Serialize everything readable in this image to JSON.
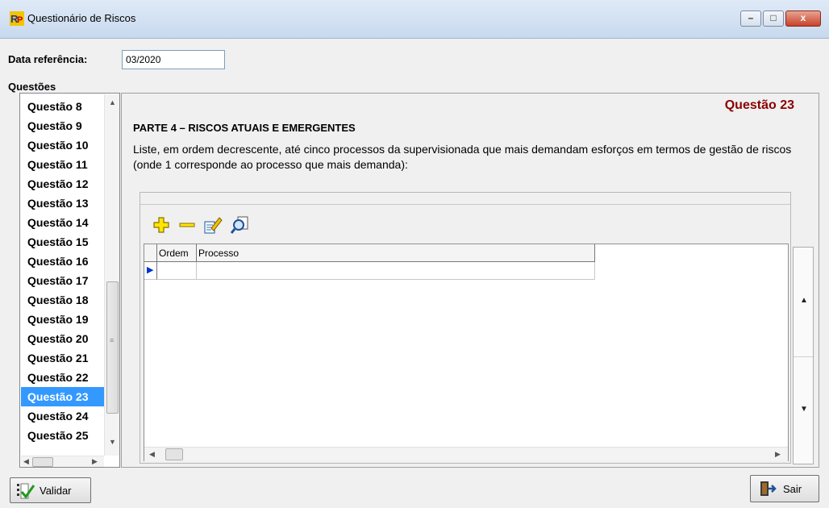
{
  "window": {
    "title": "Questionário de Riscos",
    "minimize_label": "–",
    "maximize_label": "□",
    "close_label": "x"
  },
  "form": {
    "data_ref_label": "Data referência:",
    "data_ref_value": "03/2020",
    "questoes_label": "Questões"
  },
  "questions": {
    "items": [
      "Questão 8",
      "Questão 9",
      "Questão 10",
      "Questão 11",
      "Questão 12",
      "Questão 13",
      "Questão 14",
      "Questão 15",
      "Questão 16",
      "Questão 17",
      "Questão 18",
      "Questão 19",
      "Questão 20",
      "Questão 21",
      "Questão 22",
      "Questão 23",
      "Questão 24",
      "Questão 25"
    ],
    "selected": "Questão 23"
  },
  "panel": {
    "question_number": "Questão 23",
    "part_title": "PARTE 4 – RISCOS ATUAIS E EMERGENTES",
    "question_text": "Liste, em ordem decrescente, até cinco processos da supervisionada que mais demandam esforços em termos de gestão de riscos (onde 1 corresponde ao processo que mais demanda):"
  },
  "grid": {
    "columns": [
      "Ordem",
      "Processo"
    ],
    "rows": [
      [
        "",
        ""
      ]
    ]
  },
  "toolbar": {
    "icons": [
      "add-icon",
      "remove-icon",
      "edit-icon",
      "search-icon"
    ]
  },
  "buttons": {
    "validar": "Validar",
    "sair": "Sair"
  },
  "colors": {
    "selection": "#3399ff",
    "question_number": "#8b0000"
  }
}
